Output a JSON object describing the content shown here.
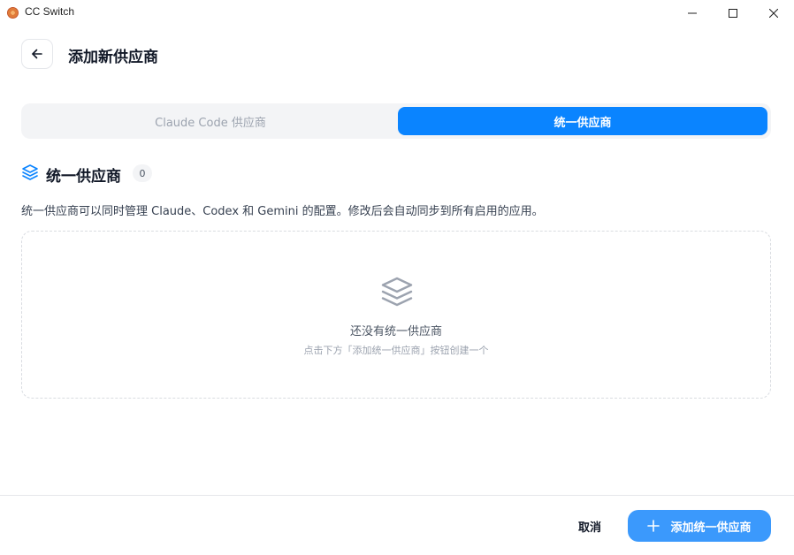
{
  "window": {
    "title": "CC Switch",
    "controls": [
      "minimize-icon",
      "maximize-icon",
      "close-icon"
    ]
  },
  "header": {
    "back_icon": "arrow-left-icon",
    "title": "添加新供应商"
  },
  "tabs": [
    {
      "label": "Claude Code 供应商",
      "active": false
    },
    {
      "label": "统一供应商",
      "active": true
    }
  ],
  "section": {
    "icon": "layers-icon",
    "title": "统一供应商",
    "count": "0",
    "description": "统一供应商可以同时管理 Claude、Codex 和 Gemini 的配置。修改后会自动同步到所有启用的应用。"
  },
  "empty_state": {
    "icon": "layers-icon",
    "title": "还没有统一供应商",
    "hint": "点击下方「添加统一供应商」按钮创建一个"
  },
  "footer": {
    "cancel_label": "取消",
    "add_label": "添加统一供应商",
    "add_icon": "plus-icon"
  },
  "colors": {
    "accent": "#0a84ff",
    "button": "#3b99fc",
    "tab_bg": "#f3f4f6"
  }
}
